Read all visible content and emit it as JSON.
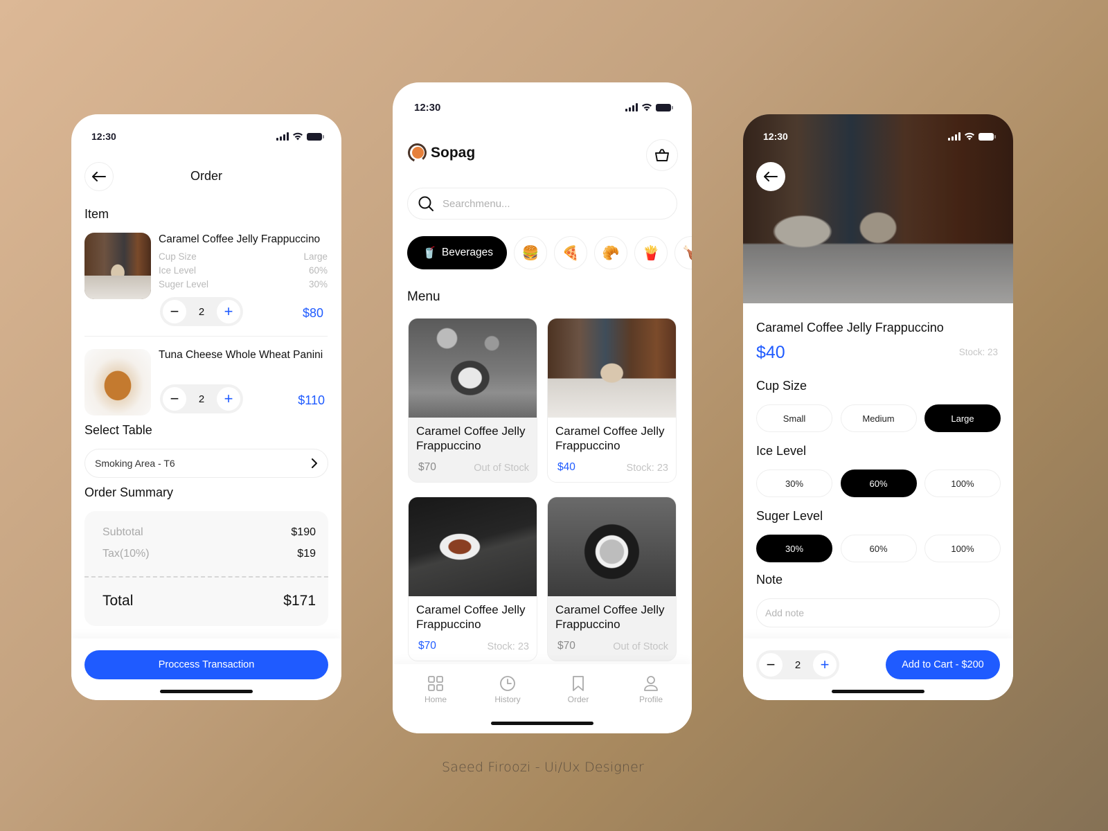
{
  "colors": {
    "accent": "#1f5bff",
    "selected_pill": "#000000",
    "muted_text": "#b9b9b9"
  },
  "order_screen": {
    "status_time": "12:30",
    "title": "Order",
    "items_heading": "Item",
    "items": [
      {
        "name": "Caramel Coffee Jelly Frappuccino",
        "options": [
          {
            "label": "Cup Size",
            "value": "Large"
          },
          {
            "label": "Ice Level",
            "value": "60%"
          },
          {
            "label": "Suger Level",
            "value": "30%"
          }
        ],
        "quantity": "2",
        "price": "$80"
      },
      {
        "name": "Tuna Cheese Whole Wheat Panini",
        "options": [],
        "quantity": "2",
        "price": "$110"
      }
    ],
    "select_table_heading": "Select Table",
    "selected_table": "Smoking Area - T6",
    "summary_heading": "Order Summary",
    "summary": {
      "subtotal_label": "Subtotal",
      "subtotal": "$190",
      "tax_label": "Tax(10%)",
      "tax": "$19",
      "total_label": "Total",
      "total": "$171"
    },
    "process_button": "Proccess Transaction"
  },
  "menu_screen": {
    "status_time": "12:30",
    "brand": "Sopag",
    "search_placeholder": "Searchmenu...",
    "categories": [
      {
        "label": "Beverages",
        "icon": "🥤",
        "active": true
      },
      {
        "icon": "🍔",
        "name": "burger"
      },
      {
        "icon": "🍕",
        "name": "pizza"
      },
      {
        "icon": "🥐",
        "name": "croissant"
      },
      {
        "icon": "🍟",
        "name": "fries"
      },
      {
        "icon": "🍗",
        "name": "chicken"
      }
    ],
    "menu_heading": "Menu",
    "products": [
      {
        "name": "Caramel Coffee Jelly Frappuccino",
        "price": "$70",
        "stock": "Out of Stock",
        "available": false
      },
      {
        "name": "Caramel Coffee Jelly Frappuccino",
        "price": "$40",
        "stock": "Stock: 23",
        "available": true
      },
      {
        "name": "Caramel Coffee Jelly Frappuccino",
        "price": "$70",
        "stock": "Stock: 23",
        "available": true
      },
      {
        "name": "Caramel Coffee Jelly Frappuccino",
        "price": "$70",
        "stock": "Out of Stock",
        "available": false
      }
    ],
    "tabs": [
      {
        "label": "Home",
        "icon": "grid-icon"
      },
      {
        "label": "History",
        "icon": "clock-icon"
      },
      {
        "label": "Order",
        "icon": "bookmark-icon"
      },
      {
        "label": "Profile",
        "icon": "user-icon"
      }
    ]
  },
  "detail_screen": {
    "status_time": "12:30",
    "name": "Caramel Coffee Jelly Frappuccino",
    "price": "$40",
    "stock": "Stock: 23",
    "cup_size": {
      "label": "Cup Size",
      "options": [
        "Small",
        "Medium",
        "Large"
      ],
      "selected": "Large"
    },
    "ice_level": {
      "label": "Ice Level",
      "options": [
        "30%",
        "60%",
        "100%"
      ],
      "selected": "60%"
    },
    "sugar_level": {
      "label": "Suger Level",
      "options": [
        "30%",
        "60%",
        "100%"
      ],
      "selected": "30%"
    },
    "note_label": "Note",
    "note_placeholder": "Add note",
    "quantity": "2",
    "add_button": "Add to Cart - $200"
  },
  "credit": "Saeed Firoozi - Ui/Ux Designer"
}
